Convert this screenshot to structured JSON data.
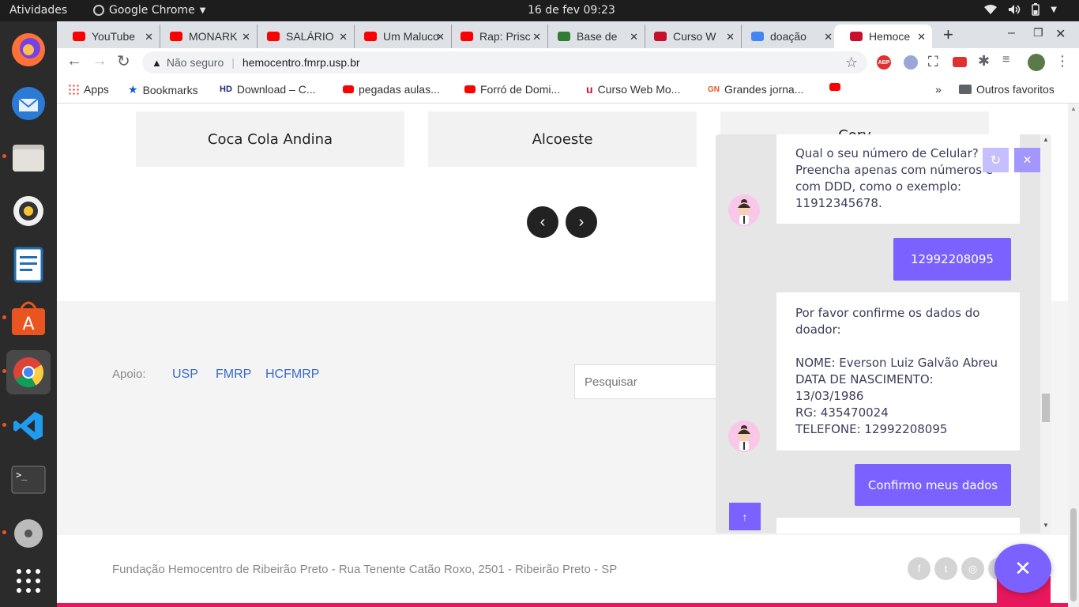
{
  "topbar": {
    "activities": "Atividades",
    "app": "Google Chrome",
    "clock": "16 de fev  09:23"
  },
  "tabs": [
    {
      "title": "YouTube",
      "color": "#ff0000"
    },
    {
      "title": "MONARK",
      "color": "#ff0000"
    },
    {
      "title": "SALÁRIO",
      "color": "#ff0000"
    },
    {
      "title": "Um Maluco",
      "color": "#ff0000"
    },
    {
      "title": "Rap: Prisc",
      "color": "#ff0000"
    },
    {
      "title": "Base de",
      "color": "#2e7d32"
    },
    {
      "title": "Curso W",
      "color": "#c8102e"
    },
    {
      "title": "doação",
      "color": "#4285f4"
    },
    {
      "title": "Hemoce",
      "color": "#c8102e"
    }
  ],
  "address": {
    "security": "Não seguro",
    "url": "hemocentro.fmrp.usp.br"
  },
  "bookmarks": {
    "apps": "Apps",
    "items": [
      "Bookmarks",
      "Download – C...",
      "pegadas aulas...",
      "Forró de Domi...",
      "Curso Web Mo...",
      "Grandes jorna..."
    ],
    "more": "»",
    "other": "Outros favoritos"
  },
  "partners": [
    "Coca Cola Andina",
    "Alcoeste",
    "Cory"
  ],
  "footer": {
    "support_label": "Apoio:",
    "links": [
      "USP",
      "FMRP",
      "HCFMRP"
    ],
    "search_placeholder": "Pesquisar",
    "address": "Fundação Hemocentro de Ribeirão Preto - Rua Tenente Catão Roxo, 2501 - Ribeirão Preto - SP"
  },
  "chat": {
    "bot_msg_1": "Qual o seu número de Celular? Preencha apenas com números e com DDD, como o exemplo: 11912345678.",
    "user_msg_1": "12992208095",
    "bot_msg_2": "Por favor confirme os dados do doador:\n\nNOME: Everson Luiz Galvão Abreu\nDATA DE NASCIMENTO: 13/03/1986\nRG: 435470024\nTELEFONE: 12992208095",
    "user_msg_2": "Confirmo meus dados"
  },
  "colors": {
    "accent": "#7b61ff",
    "brand_pink": "#e8175d",
    "link": "#3a6bc9"
  }
}
